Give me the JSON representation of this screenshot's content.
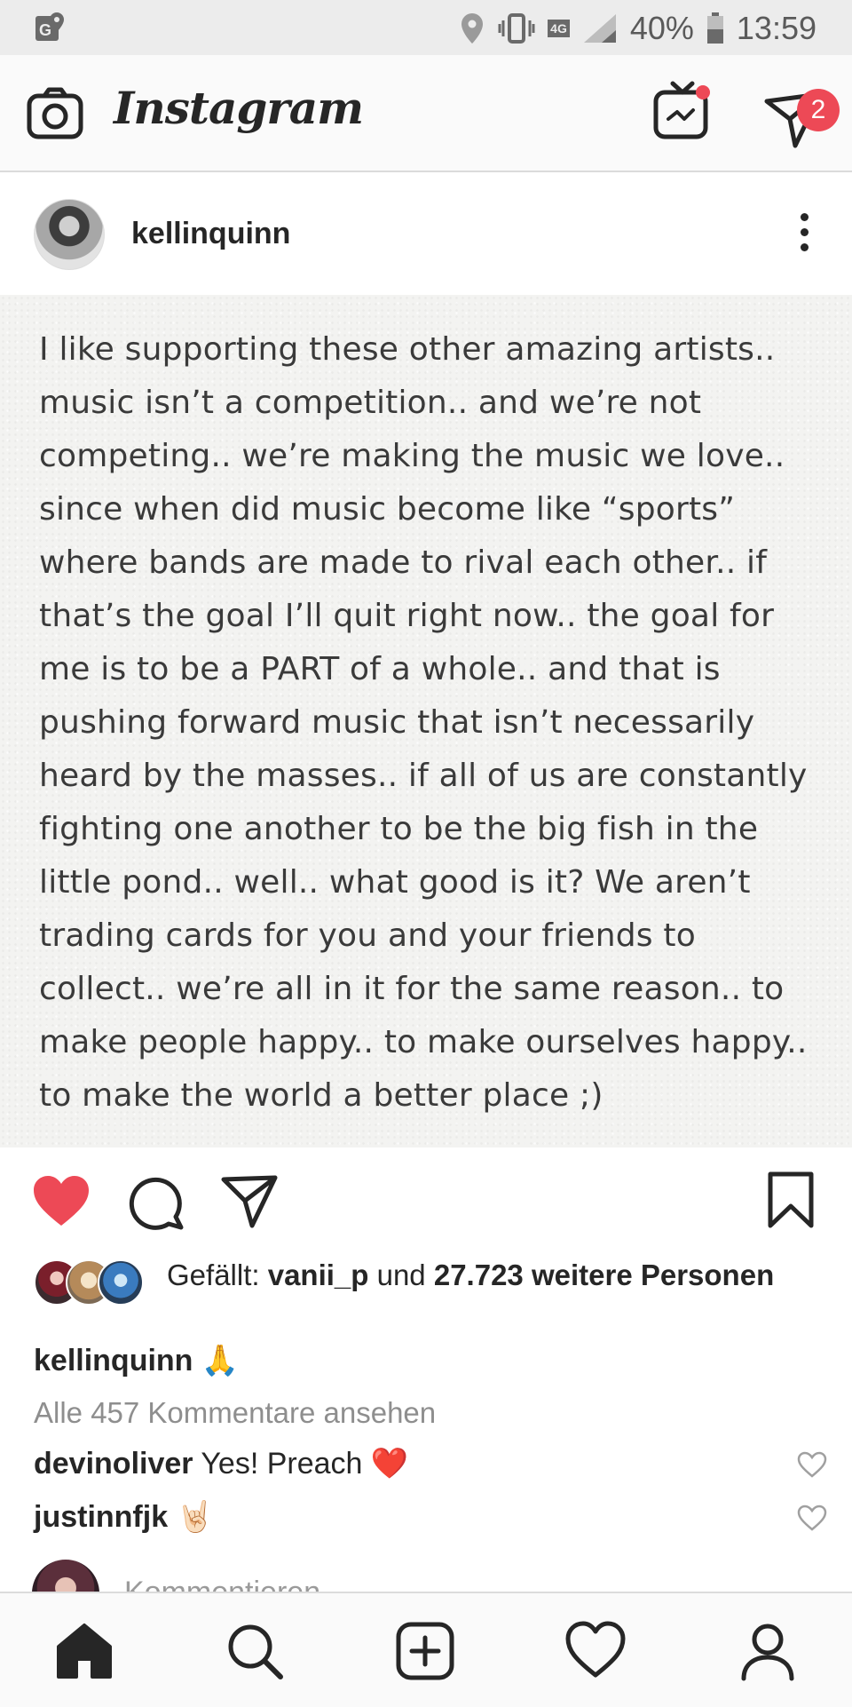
{
  "status_bar": {
    "battery": "40%",
    "time": "13:59",
    "network": "4G"
  },
  "app_header": {
    "title": "Instagram",
    "messages_badge": "2"
  },
  "post": {
    "username": "kellinquinn",
    "image_text": "I like supporting these other amazing artists..\nmusic isn’t a competition.. and we’re not\ncompeting.. we’re making the music we love..\nsince when did music become like “sports”\nwhere bands are made to rival each other.. if\nthat’s the goal I’ll quit right now.. the goal for\nme is to be a PART of a whole.. and that is\npushing forward music that isn’t necessarily\nheard by the masses.. if all of us are constantly\nfighting one another to be the big fish in the\nlittle pond.. well.. what good is it? We aren’t\ntrading cards for you and your friends to\ncollect.. we’re all in it for the same reason.. to\nmake people happy.. to make ourselves happy..\nto make the world a better place ;)",
    "likes": {
      "prefix": "Gefällt: ",
      "first_user": "vanii_p",
      "connector": " und ",
      "count_text": "27.723 weitere Personen"
    },
    "caption": {
      "username": "kellinquinn",
      "text": " 🙏"
    },
    "view_all_comments": "Alle 457 Kommentare ansehen",
    "comments": [
      {
        "username": "devinoliver",
        "text": " Yes! Preach ❤️"
      },
      {
        "username": "justinnfjk",
        "text": " 🤘🏻"
      }
    ],
    "add_comment_placeholder": "Kommentieren ..."
  },
  "colors": {
    "like_red": "#ed4956",
    "text_dark": "#262626",
    "muted": "#8e8e8e"
  },
  "icons": {
    "camera": "camera-icon",
    "igtv": "igtv-icon",
    "direct": "direct-message-icon",
    "heart": "heart-filled-icon",
    "comment": "comment-icon",
    "share": "share-icon",
    "bookmark": "bookmark-icon",
    "home": "home-icon",
    "search": "search-icon",
    "add": "add-post-icon",
    "activity": "activity-heart-icon",
    "profile": "profile-icon"
  }
}
